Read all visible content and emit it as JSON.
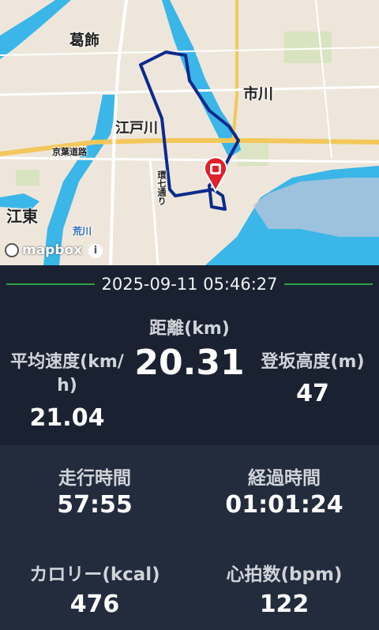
{
  "map": {
    "labels": {
      "katsushika": "葛飾",
      "ichikawa": "市川",
      "edogawa": "江戸川",
      "keiyo_road": "京葉道路",
      "kannana": "環七通り",
      "koto": "江東",
      "arakawa": "荒川"
    },
    "attribution": "mapbox",
    "info_symbol": "i",
    "route_color": "#0d2a8c",
    "marker_color": "#e0202b"
  },
  "header": {
    "datetime": "2025-09-11 05:46:27"
  },
  "stats": {
    "distance": {
      "label": "距離(km)",
      "value": "20.31"
    },
    "avg_speed": {
      "label_line1": "平均速度(km/",
      "label_line2": "h)",
      "value": "21.04"
    },
    "elevation": {
      "label": "登坂高度(m)",
      "value": "47"
    },
    "moving_time": {
      "label": "走行時間",
      "value": "57:55"
    },
    "elapsed_time": {
      "label": "経過時間",
      "value": "01:01:24"
    },
    "calories": {
      "label": "カロリー(kcal)",
      "value": "476"
    },
    "heart_rate": {
      "label": "心拍数(bpm)",
      "value": "122"
    }
  }
}
